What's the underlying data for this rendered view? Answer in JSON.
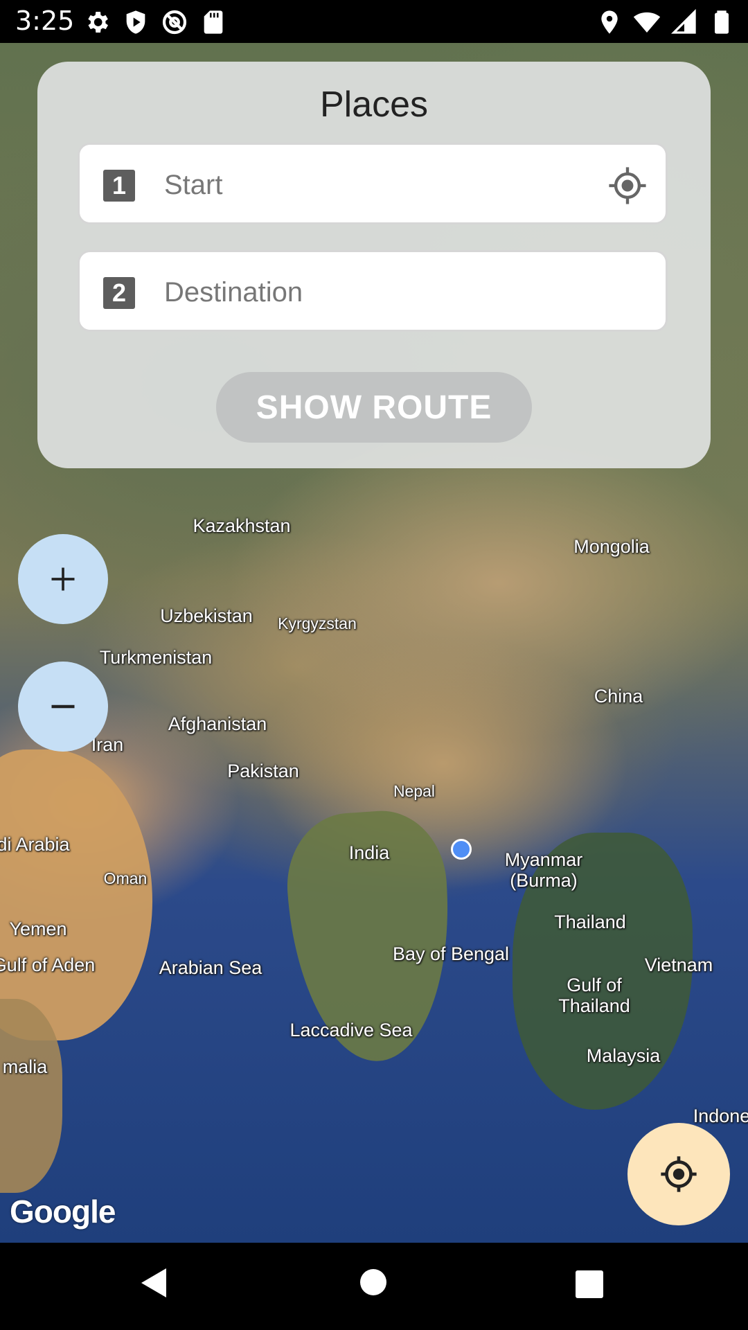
{
  "status_bar": {
    "time": "3:25",
    "left_icons": [
      "gear-icon",
      "play-protect-icon",
      "at-sign-icon",
      "sd-card-icon"
    ],
    "right_icons": [
      "location-pin-icon",
      "wifi-icon",
      "signal-icon",
      "battery-icon"
    ]
  },
  "places": {
    "title": "Places",
    "start_badge": "1",
    "start_placeholder": "Start",
    "destination_badge": "2",
    "destination_placeholder": "Destination",
    "show_route_label": "SHOW ROUTE"
  },
  "map": {
    "labels": {
      "kazakhstan": "Kazakhstan",
      "mongolia": "Mongolia",
      "uzbekistan": "Uzbekistan",
      "kyrgyzstan": "Kyrgyzstan",
      "turkmenistan": "Turkmenistan",
      "china": "China",
      "afghanistan": "Afghanistan",
      "iran": "Iran",
      "pakistan": "Pakistan",
      "nepal": "Nepal",
      "saudi_arabia": "di Arabia",
      "india": "India",
      "myanmar": "Myanmar\n(Burma)",
      "oman": "Oman",
      "thailand": "Thailand",
      "yemen": "Yemen",
      "bay_of_bengal": "Bay of Bengal",
      "gulf_of_aden": "Gulf of Aden",
      "arabian_sea": "Arabian Sea",
      "vietnam": "Vietnam",
      "gulf_of_thailand": "Gulf of\nThailand",
      "laccadive_sea": "Laccadive Sea",
      "malaysia": "Malaysia",
      "somalia": "malia",
      "indonesia": "Indone"
    },
    "attribution": "Google"
  },
  "controls": {
    "zoom_in_icon": "plus-icon",
    "zoom_out_icon": "minus-icon",
    "my_location_icon": "my-location-icon"
  },
  "colors": {
    "zoom_button_bg": "#c6dff5",
    "my_location_bg": "#fde5bb",
    "card_bg": "#e2e4e4",
    "route_button_bg": "#c1c3c3",
    "location_dot": "#4f8ef5"
  }
}
